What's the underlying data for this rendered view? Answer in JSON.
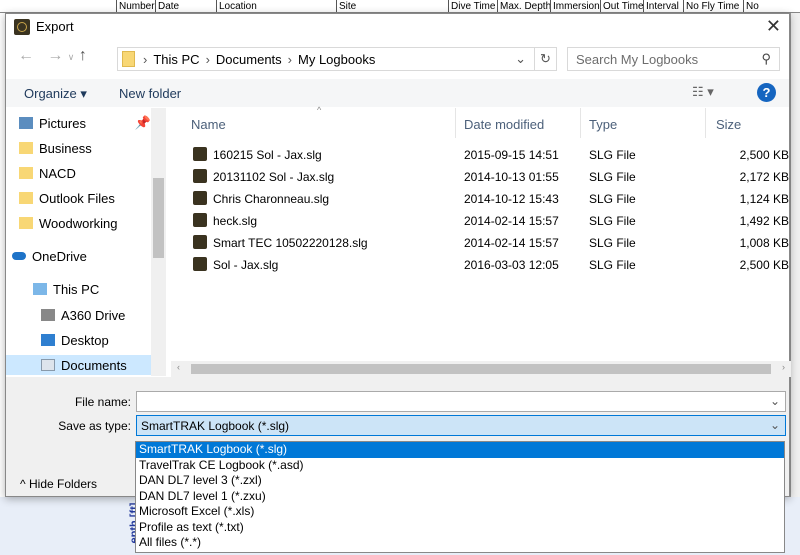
{
  "background": {
    "columns": [
      "Number",
      "Date",
      "Location",
      "Site",
      "Dive Time",
      "Max. Depth",
      "Immersion",
      "Out Time",
      "Interval",
      "No Fly Time",
      "No"
    ],
    "axis_label": "epth [ft]"
  },
  "dialog": {
    "title": "Export",
    "close": "✕"
  },
  "address": {
    "crumbs": [
      "This PC",
      "Documents",
      "My Logbooks"
    ]
  },
  "search": {
    "placeholder": "Search My Logbooks"
  },
  "toolbar": {
    "organize": "Organize ▾",
    "new_folder": "New folder",
    "help": "?"
  },
  "sidebar": {
    "items": [
      {
        "label": "Pictures"
      },
      {
        "label": "Business"
      },
      {
        "label": "NACD"
      },
      {
        "label": "Outlook Files"
      },
      {
        "label": "Woodworking"
      },
      {
        "label": "OneDrive"
      },
      {
        "label": "This PC"
      },
      {
        "label": "A360 Drive"
      },
      {
        "label": "Desktop"
      },
      {
        "label": "Documents",
        "selected": true
      }
    ]
  },
  "columns": {
    "name": "Name",
    "date": "Date modified",
    "type": "Type",
    "size": "Size"
  },
  "files": [
    {
      "name": "160215 Sol - Jax.slg",
      "date": "2015-09-15 14:51",
      "type": "SLG File",
      "size": "2,500 KB"
    },
    {
      "name": "20131102 Sol - Jax.slg",
      "date": "2014-10-13 01:55",
      "type": "SLG File",
      "size": "2,172 KB"
    },
    {
      "name": "Chris  Charonneau.slg",
      "date": "2014-10-12 15:43",
      "type": "SLG File",
      "size": "1,124 KB"
    },
    {
      "name": "heck.slg",
      "date": "2014-02-14 15:57",
      "type": "SLG File",
      "size": "1,492 KB"
    },
    {
      "name": "Smart TEC 10502220128.slg",
      "date": "2014-02-14 15:57",
      "type": "SLG File",
      "size": "1,008 KB"
    },
    {
      "name": "Sol - Jax.slg",
      "date": "2016-03-03 12:05",
      "type": "SLG File",
      "size": "2,500 KB"
    }
  ],
  "form": {
    "file_name_label": "File name:",
    "file_name_value": "",
    "save_type_label": "Save as type:",
    "save_type_value": "SmartTRAK Logbook (*.slg)",
    "hide_folders": "Hide Folders"
  },
  "save_type_options": [
    "SmartTRAK Logbook (*.slg)",
    "TravelTrak CE Logbook (*.asd)",
    "DAN DL7 level 3 (*.zxl)",
    "DAN DL7 level 1 (*.zxu)",
    "Microsoft Excel (*.xls)",
    "Profile as text (*.txt)",
    "All files (*.*)"
  ]
}
